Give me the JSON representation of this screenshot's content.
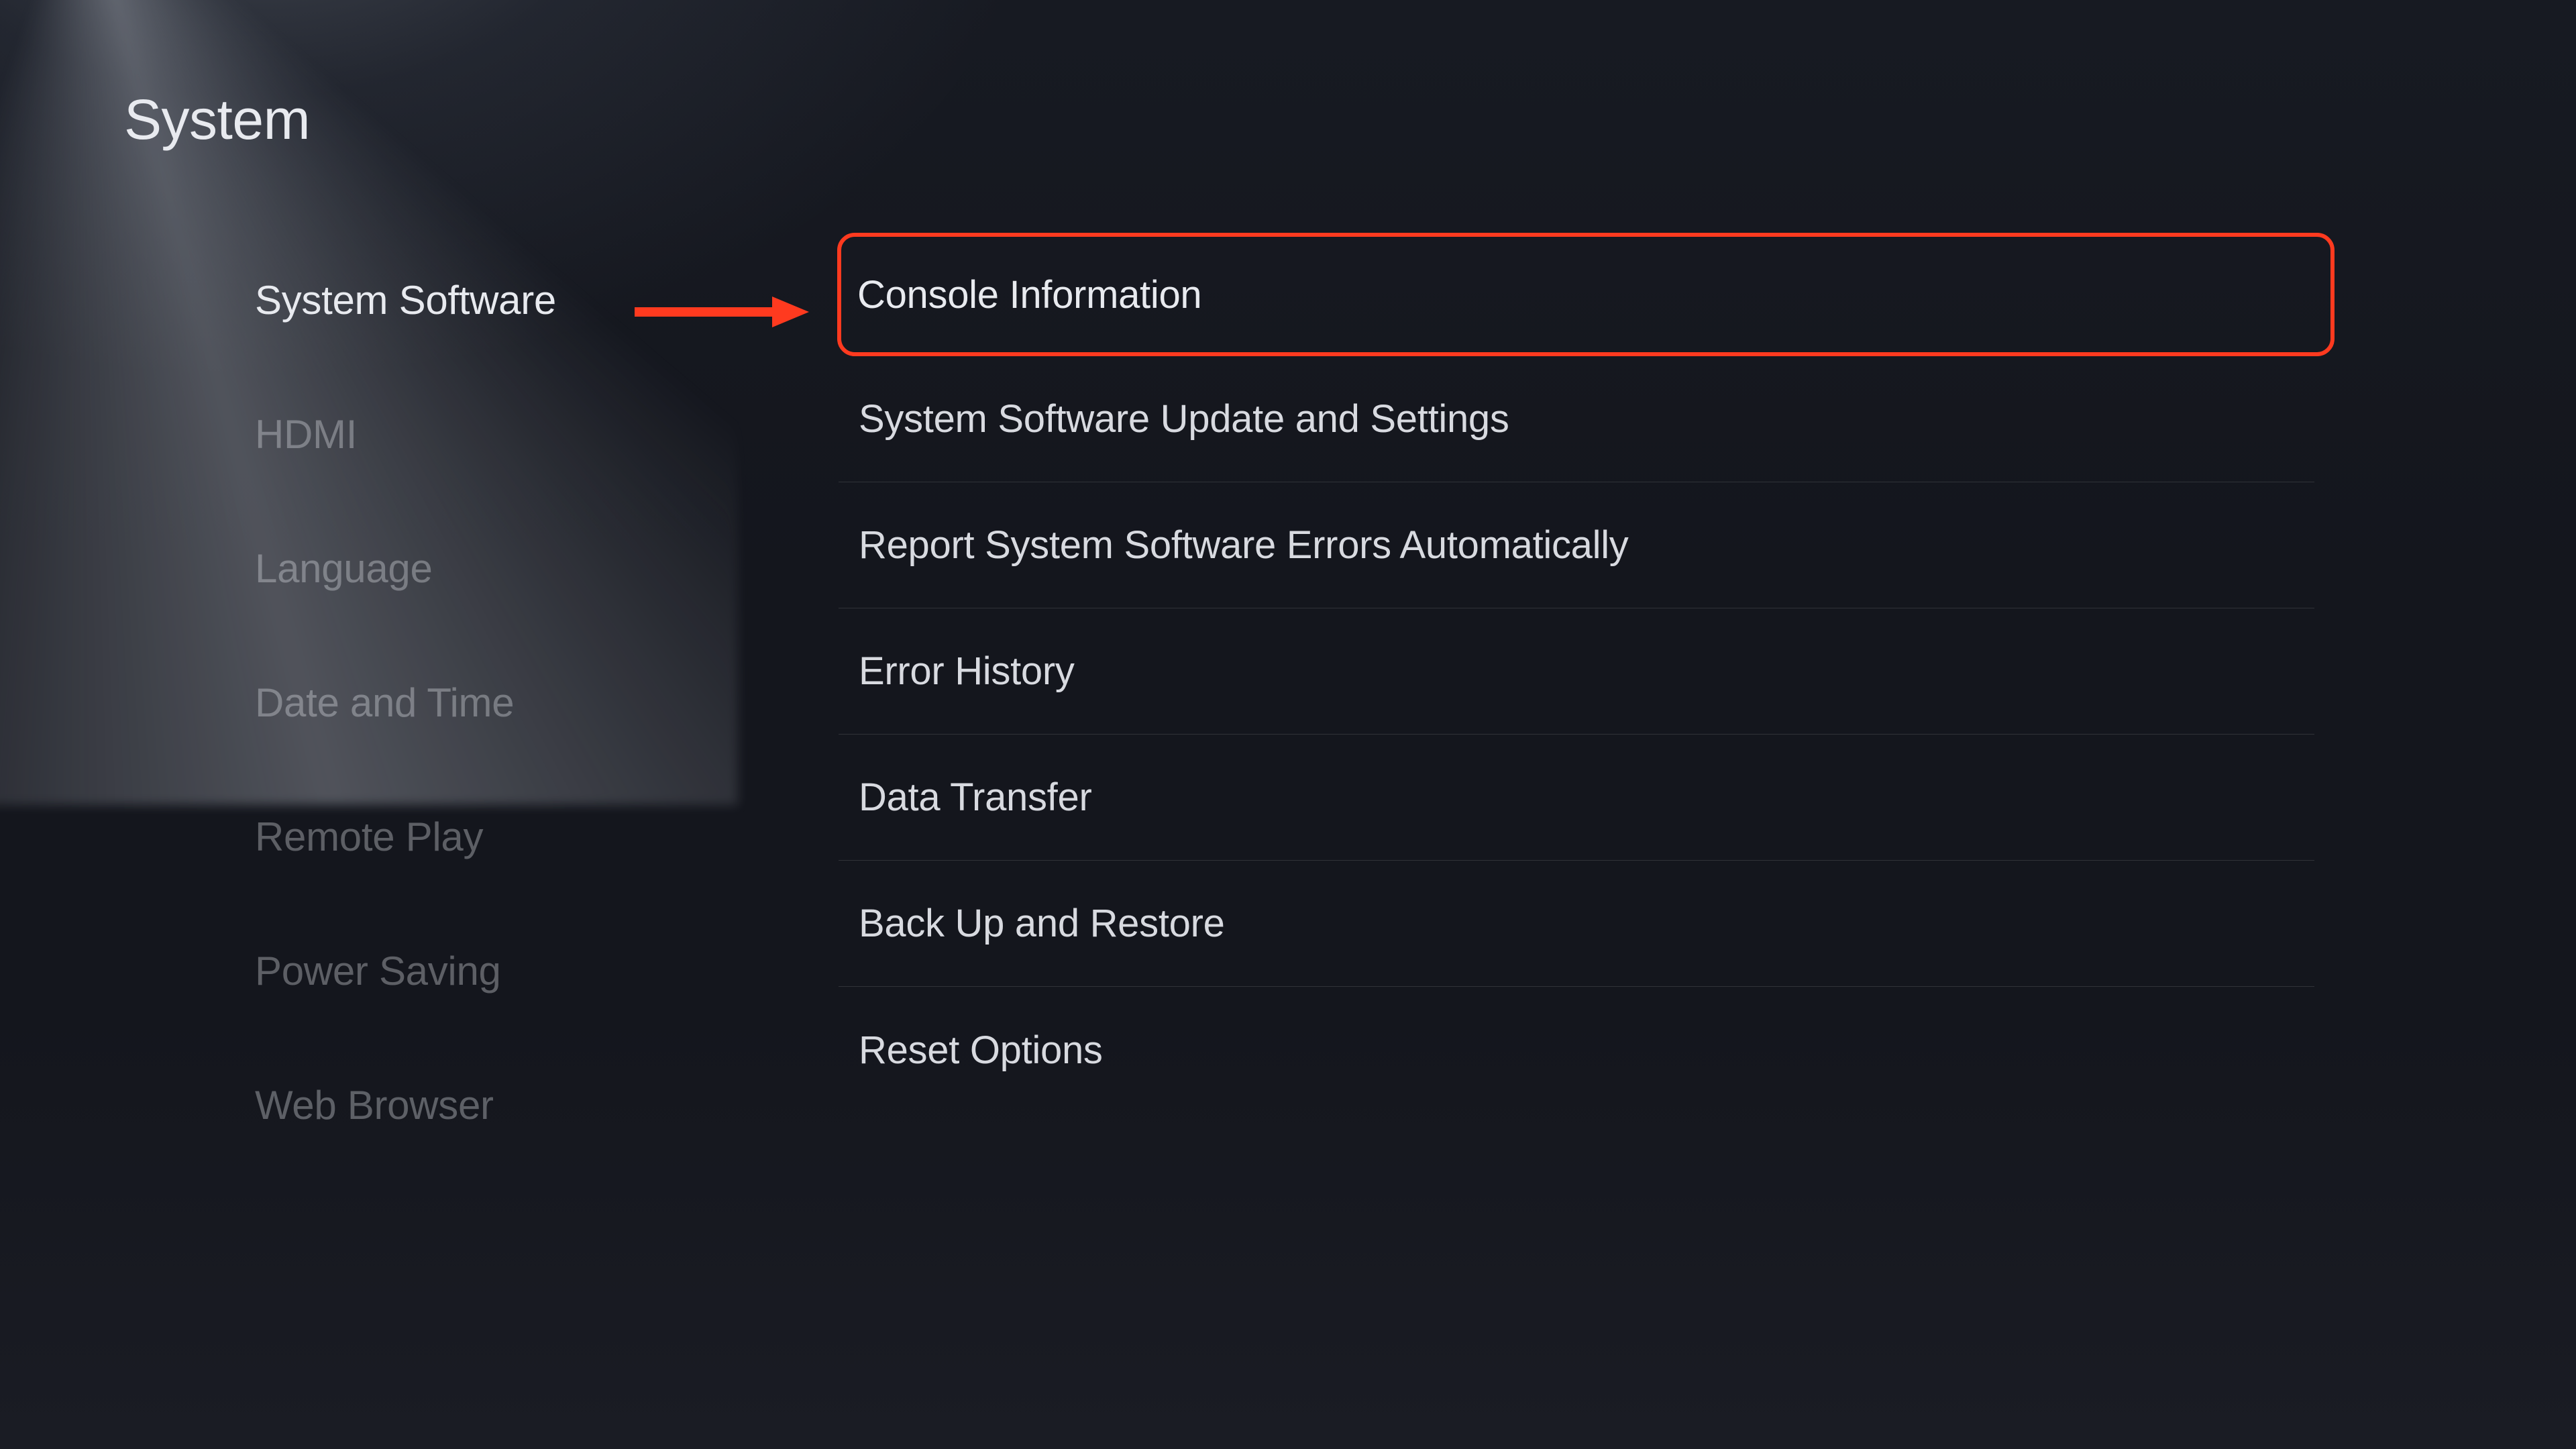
{
  "page": {
    "title": "System"
  },
  "sidebar": {
    "items": [
      {
        "label": "System Software",
        "active": true
      },
      {
        "label": "HDMI",
        "active": false
      },
      {
        "label": "Language",
        "active": false
      },
      {
        "label": "Date and Time",
        "active": false
      },
      {
        "label": "Remote Play",
        "active": false
      },
      {
        "label": "Power Saving",
        "active": false
      },
      {
        "label": "Web Browser",
        "active": false
      }
    ]
  },
  "main": {
    "items": [
      {
        "label": "Console Information",
        "highlighted": true
      },
      {
        "label": "System Software Update and Settings",
        "highlighted": false
      },
      {
        "label": "Report System Software Errors Automatically",
        "highlighted": false
      },
      {
        "label": "Error History",
        "highlighted": false
      },
      {
        "label": "Data Transfer",
        "highlighted": false
      },
      {
        "label": "Back Up and Restore",
        "highlighted": false
      },
      {
        "label": "Reset Options",
        "highlighted": false
      }
    ]
  },
  "annotation": {
    "arrow_color": "#ff3a1f"
  }
}
